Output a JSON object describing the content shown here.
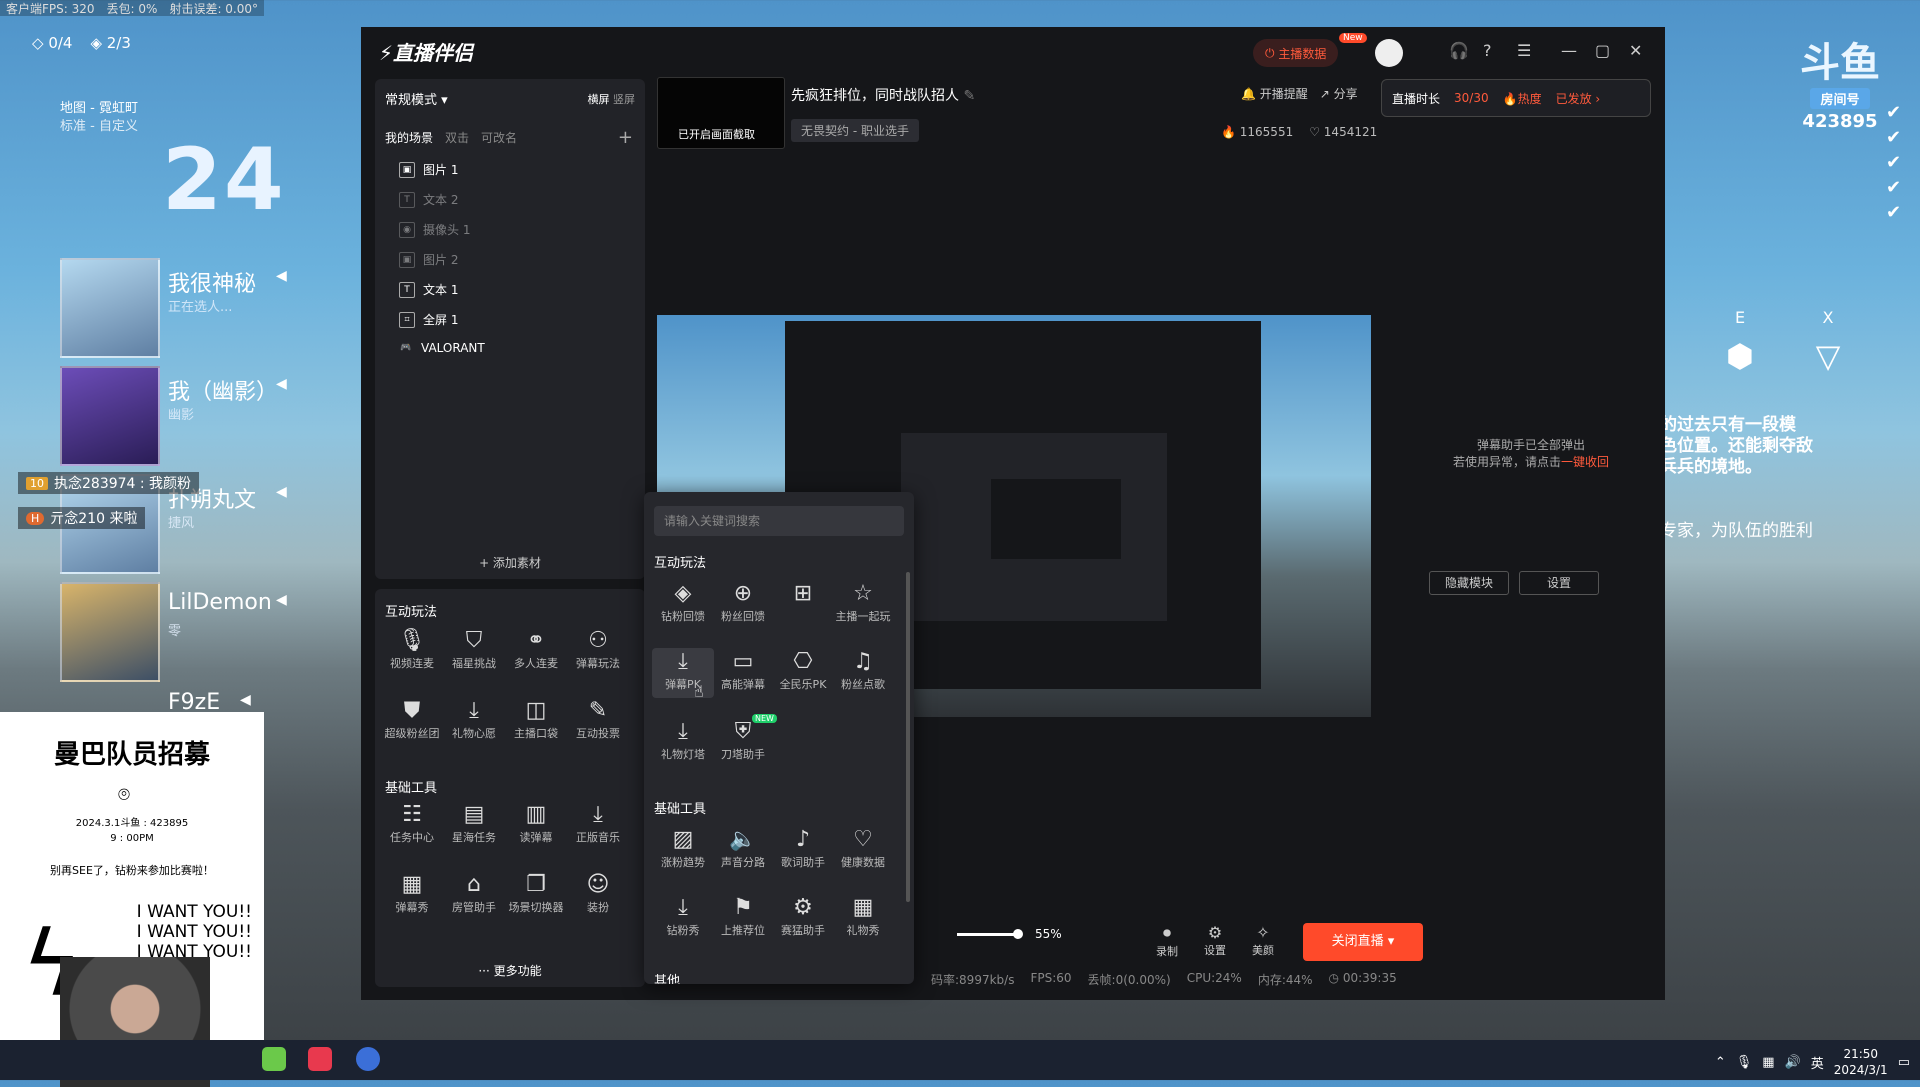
{
  "hud": {
    "fps": "客户端FPS: 320",
    "loss": "丢包: 0%",
    "error": "射击误差: 0.00°",
    "count_a": "0/4",
    "count_b": "2/3",
    "map_name": "地图 - 霓虹町",
    "map_mode": "标准 - 自定义",
    "timer": "24"
  },
  "players": [
    {
      "name": "我很神秘",
      "sub": "正在选人..."
    },
    {
      "name": "我（幽影）",
      "sub": "幽影"
    },
    {
      "name": "扑朔丸文",
      "sub": "捷风"
    },
    {
      "name": "LilDemon",
      "sub": "零"
    },
    {
      "name": "F9zE",
      "sub": ""
    }
  ],
  "chat": [
    {
      "badge": "10",
      "text": "执念283974 : 我颜粉"
    },
    {
      "badge": "H",
      "text": "亓念210 来啦"
    }
  ],
  "recruit": {
    "title": "曼巴队员招募",
    "line1": "2024.3.1斗鱼 : 423895",
    "line2": "9 : 00PM",
    "line3": "别再SEE了，钻粉来参加比赛啦！",
    "shout1": "I WANT YOU!!",
    "shout2": "I WANT YOU!!",
    "shout3": "I WANT YOU!!"
  },
  "room": {
    "logo": "斗鱼",
    "label": "房间号",
    "number": "423895"
  },
  "abilities": {
    "e": "E",
    "x": "X"
  },
  "right_text": {
    "l1": "的过去只有一段模",
    "l2": "色位置。还能剩夺敌",
    "l3": "兵兵的境地。",
    "l4": "专家，为队伍的胜利"
  },
  "app": {
    "logo": "直播伴侣",
    "host_data": "主播数据",
    "new_badge": "New",
    "scene": {
      "mode": "常规模式 ▾",
      "orient_h": "横屏",
      "orient_v": "竖屏",
      "tab_my": "我的场景",
      "tab_dbl": "双击",
      "tab_rename": "可改名",
      "items": [
        "图片 1",
        "文本 2",
        "摄像头 1",
        "图片 2",
        "文本 1",
        "全屏 1",
        "VALORANT"
      ],
      "add": "+ 添加素材"
    },
    "tools": {
      "sec1": "互动玩法",
      "row1": [
        "视频连麦",
        "福星挑战",
        "多人连麦",
        "弹幕玩法"
      ],
      "row2": [
        "超级粉丝团",
        "礼物心愿",
        "主播口袋",
        "互动投票"
      ],
      "sec2": "基础工具",
      "row3": [
        "任务中心",
        "星海任务",
        "读弹幕",
        "正版音乐"
      ],
      "row4": [
        "弹幕秀",
        "房管助手",
        "场景切换器",
        "装扮"
      ],
      "more": "··· 更多功能"
    },
    "stream": {
      "thumb_label": "已开启画面截取",
      "title": "先疯狂排位，同时战队招人",
      "tag": "无畏契约 - 职业选手",
      "fans": "1165551",
      "likes": "1454121",
      "remind": "开播提醒",
      "share": "分享",
      "duration_label": "直播时长",
      "duration_value": "30/30",
      "hot": "热度",
      "sent": "已发放 ›"
    },
    "danmu": {
      "l1": "弹幕助手已全部弹出",
      "l2": "若使用异常，请点击",
      "link": "一键收回",
      "hide": "隐藏模块",
      "settings": "设置"
    },
    "bottom": {
      "volume": "55%",
      "record": "录制",
      "settings": "设置",
      "beauty": "美颜",
      "close": "关闭直播 ▾"
    },
    "status": {
      "bitrate": "码率:8997kb/s",
      "fps": "FPS:60",
      "drop": "丢帧:0(0.00%)",
      "cpu": "CPU:24%",
      "mem": "内存:44%",
      "time": "00:39:35"
    }
  },
  "popup": {
    "placeholder": "请输入关键词搜索",
    "sec1": "互动玩法",
    "row1": [
      "钻粉回馈",
      "粉丝回馈",
      "",
      "主播一起玩"
    ],
    "row2": [
      "弹幕PK",
      "高能弹幕",
      "全民乐PK",
      "粉丝点歌"
    ],
    "row3": [
      "礼物灯塔",
      "刀塔助手"
    ],
    "new_badge": "NEW",
    "sec2": "基础工具",
    "row4": [
      "涨粉趋势",
      "声音分路",
      "歌词助手",
      "健康数据"
    ],
    "row5": [
      "钻粉秀",
      "上推荐位",
      "赛猛助手",
      "礼物秀"
    ],
    "sec3": "其他"
  },
  "taskbar": {
    "ime": "英",
    "time": "21:50",
    "date": "2024/3/1"
  }
}
